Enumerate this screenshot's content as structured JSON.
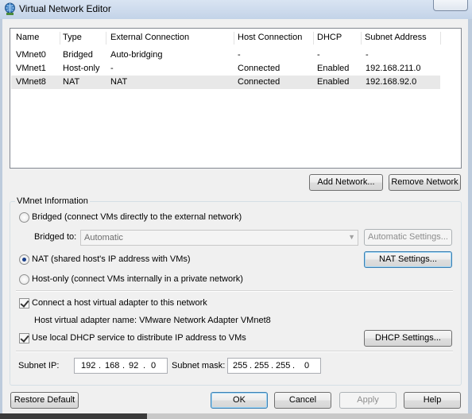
{
  "window": {
    "title": "Virtual Network Editor"
  },
  "table": {
    "columns": [
      "Name",
      "Type",
      "External Connection",
      "Host Connection",
      "DHCP",
      "Subnet Address"
    ],
    "rows": [
      [
        "VMnet0",
        "Bridged",
        "Auto-bridging",
        "-",
        "-",
        "-"
      ],
      [
        "VMnet1",
        "Host-only",
        "-",
        "Connected",
        "Enabled",
        "192.168.211.0"
      ],
      [
        "VMnet8",
        "NAT",
        "NAT",
        "Connected",
        "Enabled",
        "192.168.92.0"
      ]
    ],
    "selected_row": 2
  },
  "table_buttons": {
    "add": "Add Network...",
    "remove": "Remove Network"
  },
  "vmnet_info": {
    "group_label": "VMnet Information",
    "bridged_label": "Bridged (connect VMs directly to the external network)",
    "bridged_to_label": "Bridged to:",
    "bridged_to_value": "Automatic",
    "automatic_settings": "Automatic Settings...",
    "nat_label": "NAT (shared host's IP address with VMs)",
    "nat_settings": "NAT Settings...",
    "hostonly_label": "Host-only (connect VMs internally in a private network)",
    "selected_mode": "NAT",
    "connect_adapter_label": "Connect a host virtual adapter to this network",
    "connect_adapter_checked": true,
    "adapter_name_label": "Host virtual adapter name: VMware Network Adapter VMnet8",
    "dhcp_label": "Use local DHCP service to distribute IP address to VMs",
    "dhcp_checked": true,
    "dhcp_settings": "DHCP Settings...",
    "subnet_ip_label": "Subnet IP:",
    "subnet_ip": [
      "192",
      "168",
      "92",
      "0"
    ],
    "subnet_mask_label": "Subnet mask:",
    "subnet_mask": [
      "255",
      "255",
      "255",
      "0"
    ]
  },
  "footer": {
    "restore": "Restore Default",
    "ok": "OK",
    "cancel": "Cancel",
    "apply": "Apply",
    "help": "Help"
  }
}
